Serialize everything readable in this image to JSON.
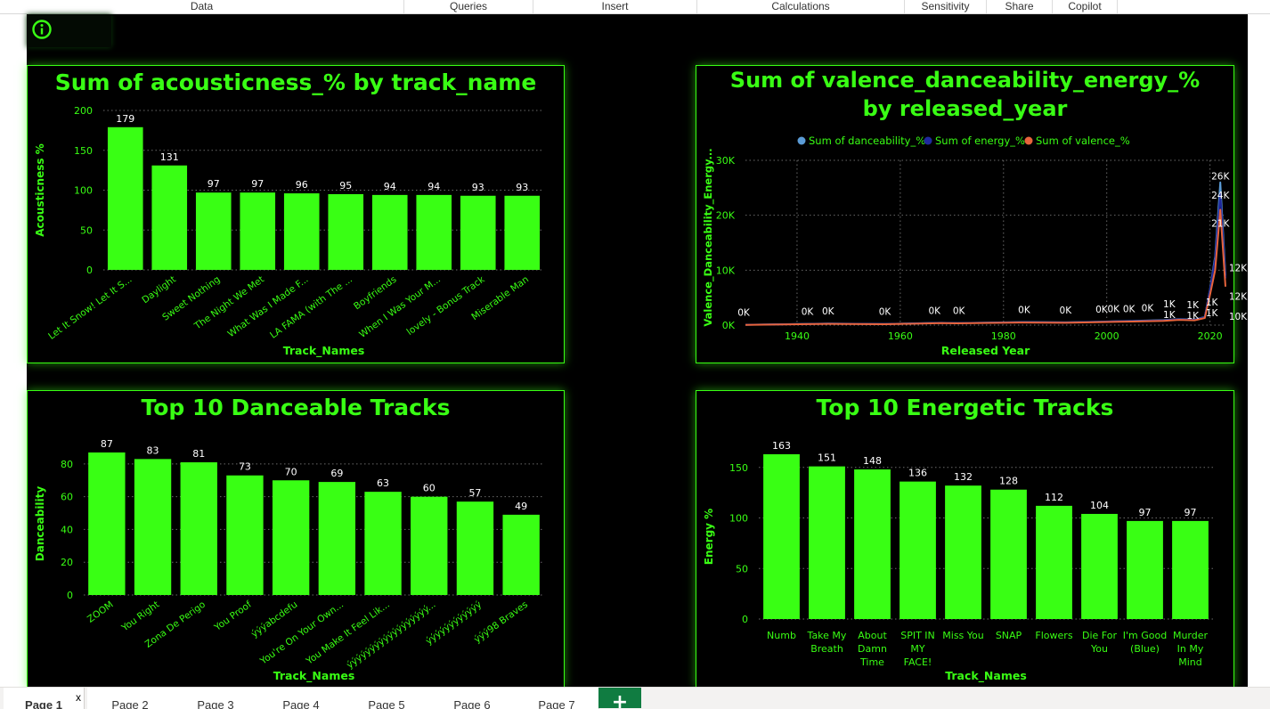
{
  "ribbon": {
    "items": [
      "Data",
      "Queries",
      "Insert",
      "Calculations",
      "Sensitivity",
      "Share",
      "Copilot"
    ]
  },
  "tabs": [
    "Page 1",
    "Page 2",
    "Page 3",
    "Page 4",
    "Page 5",
    "Page 6",
    "Page 7"
  ],
  "tab_close_label": "x",
  "add_page_label": "+",
  "info_icon": "info-circle-icon",
  "colors": {
    "background": "#000000",
    "accent": "#39ff14",
    "bar": "#39ff14",
    "danceability": "#5b9bd5",
    "energy": "#1f2a9e",
    "valence": "#e8643c"
  },
  "chart_data": [
    {
      "type": "bar",
      "title": "Sum of acousticness_% by track_name",
      "xlabel": "Track_Names",
      "ylabel": "Acousticness %",
      "ylim": [
        0,
        200
      ],
      "yticks": [
        0,
        50,
        100,
        150,
        200
      ],
      "categories": [
        "Let It Snow! Let It S...",
        "Daylight",
        "Sweet Nothing",
        "The Night We Met",
        "What Was I Made F...",
        "LA FAMA (with The ...",
        "Boyfriends",
        "When I Was Your M...",
        "lovely - Bonus Track",
        "Miserable Man"
      ],
      "values": [
        179,
        131,
        97,
        97,
        96,
        95,
        94,
        94,
        93,
        93
      ],
      "data_labels": [
        "179",
        "131",
        "97",
        "97",
        "96",
        "95",
        "94",
        "94",
        "93",
        "93"
      ],
      "grid": true
    },
    {
      "type": "line",
      "title": "Sum of valence_danceability_energy_% by released_year",
      "xlabel": "Released Year",
      "ylabel": "Valence_Danceability_Energy...",
      "xlim": [
        1930,
        2023
      ],
      "ylim": [
        0,
        30000
      ],
      "xticks": [
        1940,
        1960,
        1980,
        2000,
        2020
      ],
      "ytick_values": [
        0,
        10000,
        20000,
        30000
      ],
      "ytick_labels": [
        "0K",
        "10K",
        "20K",
        "30K"
      ],
      "legend_position": "top",
      "grid": true,
      "series": [
        {
          "name": "Sum of danceability_%",
          "x": [
            1930,
            1942,
            1946,
            1957,
            1968,
            1971,
            1984,
            1992,
            1999,
            2002,
            2005,
            2011,
            2014,
            2017,
            2019,
            2020,
            2021,
            2022,
            2023
          ],
          "y": [
            60,
            220,
            290,
            210,
            420,
            380,
            560,
            500,
            640,
            710,
            760,
            900,
            1100,
            1000,
            1500,
            6500,
            12500,
            26000,
            9000
          ]
        },
        {
          "name": "Sum of energy_%",
          "x": [
            1930,
            1942,
            1946,
            1957,
            1968,
            1971,
            1984,
            1992,
            1999,
            2002,
            2005,
            2011,
            2014,
            2017,
            2019,
            2020,
            2021,
            2022,
            2023
          ],
          "y": [
            60,
            200,
            260,
            190,
            400,
            360,
            520,
            470,
            610,
            680,
            730,
            860,
            1050,
            950,
            1450,
            6400,
            12000,
            24000,
            8500
          ]
        },
        {
          "name": "Sum of valence_%",
          "x": [
            1930,
            1942,
            1946,
            1957,
            1968,
            1971,
            1984,
            1992,
            1999,
            2002,
            2005,
            2011,
            2014,
            2017,
            2019,
            2020,
            2021,
            2022,
            2023
          ],
          "y": [
            50,
            180,
            230,
            170,
            360,
            330,
            470,
            420,
            550,
            610,
            650,
            780,
            950,
            870,
            1300,
            5500,
            10000,
            21000,
            7000
          ]
        }
      ],
      "data_labels": [
        {
          "x": 1930,
          "y": 60,
          "text": "0K"
        },
        {
          "x": 1942,
          "y": 220,
          "text": "0K"
        },
        {
          "x": 1946,
          "y": 290,
          "text": "0K"
        },
        {
          "x": 1957,
          "y": 210,
          "text": "0K"
        },
        {
          "x": 1968,
          "y": 420,
          "text": "0K"
        },
        {
          "x": 1971,
          "y": 380,
          "text": "0K"
        },
        {
          "x": 1984,
          "y": 560,
          "text": "0K"
        },
        {
          "x": 1992,
          "y": 500,
          "text": "0K"
        },
        {
          "x": 1999,
          "y": 640,
          "text": "0K"
        },
        {
          "x": 2002,
          "y": 710,
          "text": "0K"
        },
        {
          "x": 2005,
          "y": 760,
          "text": "0K"
        },
        {
          "x": 2011,
          "y": 900,
          "text": "0K"
        },
        {
          "x": 2014,
          "y": 1100,
          "text": "1K"
        },
        {
          "x": 2014,
          "y": 1100,
          "text": "1K"
        },
        {
          "x": 2017,
          "y": 1000,
          "text": "1K"
        },
        {
          "x": 2017,
          "y": 1000,
          "text": "1K"
        },
        {
          "x": 2020,
          "y": 1500,
          "text": "1K"
        },
        {
          "x": 2020,
          "y": 1500,
          "text": "1K"
        },
        {
          "x": 2022,
          "y": 26000,
          "text": "26K"
        },
        {
          "x": 2022,
          "y": 24000,
          "text": "24K"
        },
        {
          "x": 2022,
          "y": 21000,
          "text": "21K"
        },
        {
          "x": 2023,
          "y": 9000,
          "text": "12K"
        },
        {
          "x": 2023,
          "y": 8500,
          "text": "12K"
        },
        {
          "x": 2023,
          "y": 7000,
          "text": "10K"
        }
      ]
    },
    {
      "type": "bar",
      "title": "Top 10 Danceable Tracks",
      "xlabel": "Track_Names",
      "ylabel": "Danceability",
      "ylim": [
        0,
        87
      ],
      "yticks": [
        0,
        20,
        40,
        60,
        80
      ],
      "categories": [
        "ZOOM",
        "You Right",
        "Zona De Perigo",
        "You Proof",
        "ýýýabcdefu",
        "You're On Your Own...",
        "You Make It Feel Lik...",
        "ýýýýýýýýýýýýýýýýýý...",
        "ýýýýýýýýýýýý",
        "ýýý98 Braves"
      ],
      "values": [
        87,
        83,
        81,
        73,
        70,
        69,
        63,
        60,
        57,
        49
      ],
      "data_labels": [
        "87",
        "83",
        "81",
        "73",
        "70",
        "69",
        "63",
        "60",
        "57",
        "49"
      ],
      "grid": true
    },
    {
      "type": "bar",
      "title": "Top 10 Energetic Tracks",
      "xlabel": "Track_Names",
      "ylabel": "Energy %",
      "ylim": [
        0,
        163
      ],
      "yticks": [
        0,
        50,
        100,
        150
      ],
      "categories": [
        "Numb",
        "Take My Breath",
        "About Damn Time",
        "SPIT IN MY FACE!",
        "Miss You",
        "SNAP",
        "Flowers",
        "Die For You",
        "I'm Good (Blue)",
        "Murder In My Mind"
      ],
      "category_lines": [
        [
          "Numb"
        ],
        [
          "Take My",
          "Breath"
        ],
        [
          "About",
          "Damn",
          "Time"
        ],
        [
          "SPIT IN",
          "MY",
          "FACE!"
        ],
        [
          "Miss You"
        ],
        [
          "SNAP"
        ],
        [
          "Flowers"
        ],
        [
          "Die For",
          "You"
        ],
        [
          "I'm Good",
          "(Blue)"
        ],
        [
          "Murder",
          "In My",
          "Mind"
        ]
      ],
      "values": [
        163,
        151,
        148,
        136,
        132,
        128,
        112,
        104,
        97,
        97
      ],
      "data_labels": [
        "163",
        "151",
        "148",
        "136",
        "132",
        "128",
        "112",
        "104",
        "97",
        "97"
      ],
      "grid": true
    }
  ]
}
